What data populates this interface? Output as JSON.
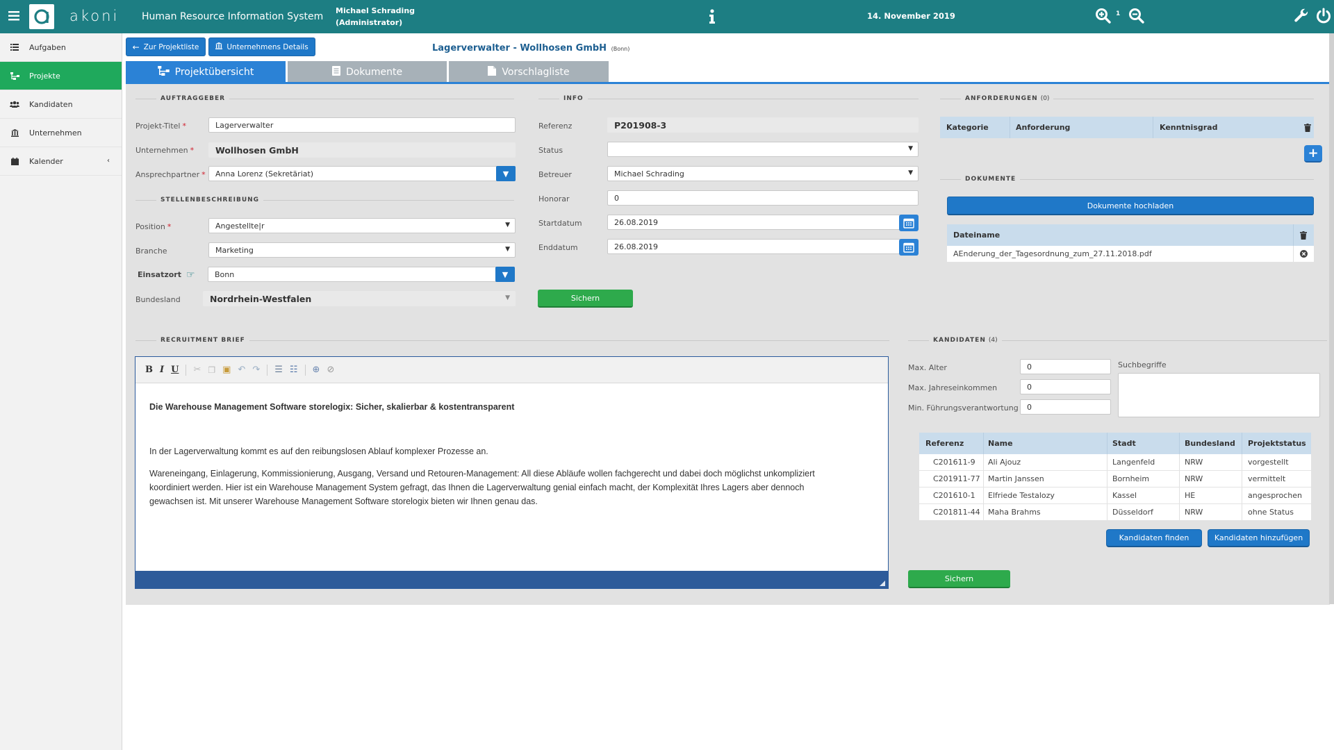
{
  "app": {
    "logo": "akoni",
    "subtitle": "Human Resource Information System",
    "user_name": "Michael Schrading",
    "user_role": "(Administrator)",
    "date": "14. November 2019",
    "zoom_level": "1"
  },
  "sidebar": {
    "items": [
      {
        "label": "Aufgaben",
        "icon": "tasks-icon"
      },
      {
        "label": "Projekte",
        "icon": "sitemap-icon"
      },
      {
        "label": "Kandidaten",
        "icon": "users-icon"
      },
      {
        "label": "Unternehmen",
        "icon": "building-icon"
      },
      {
        "label": "Kalender",
        "icon": "calendar-icon"
      }
    ],
    "active": "Projekte"
  },
  "header": {
    "back_button": "Zur Projektliste",
    "company_button": "Unternehmens Details",
    "title": "Lagerverwalter - Wollhosen GmbH",
    "location": "(Bonn)"
  },
  "tabs": [
    {
      "label": "Projektübersicht",
      "icon": "sitemap-icon"
    },
    {
      "label": "Dokumente",
      "icon": "document-icon"
    },
    {
      "label": "Vorschlagliste",
      "icon": "file-icon"
    }
  ],
  "auftraggeber": {
    "section": "AUFTRAGGEBER",
    "projekt_titel_label": "Projekt-Titel",
    "projekt_titel_value": "Lagerverwalter",
    "unternehmen_label": "Unternehmen",
    "unternehmen_value": "Wollhosen GmbH",
    "ansprechpartner_label": "Ansprechpartner",
    "ansprechpartner_value": "Anna Lorenz (Sekretäriat)",
    "required_mark": "*"
  },
  "stellen": {
    "section": "STELLENBESCHREIBUNG",
    "position_label": "Position",
    "position_value": "Angestellte|r",
    "branche_label": "Branche",
    "branche_value": "Marketing",
    "einsatzort_label": "Einsatzort",
    "einsatzort_value": "Bonn",
    "bundesland_label": "Bundesland",
    "bundesland_value": "Nordrhein-Westfalen"
  },
  "info": {
    "section": "INFO",
    "referenz_label": "Referenz",
    "referenz_value": "P201908-3",
    "status_label": "Status",
    "status_value": "",
    "betreuer_label": "Betreuer",
    "betreuer_value": "Michael Schrading",
    "honorar_label": "Honorar",
    "honorar_value": "0",
    "startdatum_label": "Startdatum",
    "startdatum_value": "26.08.2019",
    "enddatum_label": "Enddatum",
    "enddatum_value": "26.08.2019",
    "save_button": "Sichern"
  },
  "anforderungen": {
    "section": "ANFORDERUNGEN",
    "count": "(0)",
    "columns": [
      "Kategorie",
      "Anforderung",
      "Kenntnisgrad"
    ]
  },
  "dokumente": {
    "section": "DOKUMENTE",
    "upload_button": "Dokumente hochladen",
    "column": "Dateiname",
    "files": [
      "AEnderung_der_Tagesordnung_zum_27.11.2018.pdf"
    ]
  },
  "brief": {
    "section": "RECRUITMENT BRIEF",
    "toolbar": [
      "B",
      "I",
      "U"
    ],
    "heading": "Die Warehouse Management Software storelogix: Sicher, skalierbar & kostentransparent",
    "para1": "In der Lagerverwaltung kommt es auf den reibungslosen Ablauf komplexer Prozesse an.",
    "para2_line1": "Wareneingang, Einlagerung, Kommissionierung, Ausgang, Versand und Retouren-Management: All diese Abläufe wollen fachgerecht und dabei doch möglichst unkompliziert",
    "para2_line2": "koordiniert werden. Hier ist ein Warehouse Management System gefragt, das Ihnen die Lagerverwaltung genial einfach macht, der Komplexität Ihres Lagers aber dennoch",
    "para2_line3": "gewachsen ist. Mit unserer Warehouse Management Software storelogix bieten wir Ihnen genau das."
  },
  "kandidaten": {
    "section": "KANDIDATEN",
    "count": "(4)",
    "max_alter_label": "Max. Alter",
    "max_alter_value": "0",
    "max_jahres_label": "Max. Jahreseinkommen",
    "max_jahres_value": "0",
    "min_fuehrung_label": "Min. Führungsverantwortung",
    "min_fuehrung_value": "0",
    "suchbegriffe_label": "Suchbegriffe",
    "columns": [
      "Referenz",
      "Name",
      "Stadt",
      "Bundesland",
      "Projektstatus"
    ],
    "rows": [
      [
        "C201611-9",
        "Ali Ajouz",
        "Langenfeld",
        "NRW",
        "vorgestellt"
      ],
      [
        "C201911-77",
        "Martin Janssen",
        "Bornheim",
        "NRW",
        "vermittelt"
      ],
      [
        "C201610-1",
        "Elfriede Testalozy",
        "Kassel",
        "HE",
        "angesprochen"
      ],
      [
        "C201811-44",
        "Maha Brahms",
        "Düsseldorf",
        "NRW",
        "ohne Status"
      ]
    ],
    "find_button": "Kandidaten finden",
    "add_button": "Kandidaten hinzufügen",
    "save_button": "Sichern"
  }
}
